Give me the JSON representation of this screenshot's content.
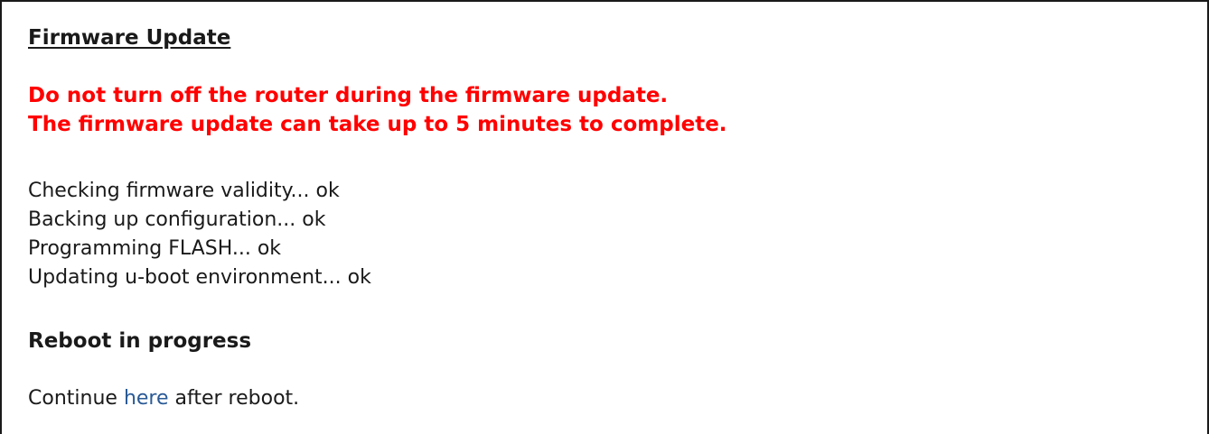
{
  "page": {
    "title": "Firmware Update",
    "warnings": [
      "Do not turn off the router during the firmware update.",
      "The firmware update can take up to 5 minutes to complete."
    ],
    "log": [
      "Checking firmware validity... ok",
      "Backing up configuration... ok",
      "Programming FLASH... ok",
      "Updating u-boot environment... ok"
    ],
    "reboot_heading": "Reboot in progress",
    "continue": {
      "prefix": "Continue",
      "link_text": "here",
      "suffix": "after reboot."
    }
  },
  "colors": {
    "warning": "#ff0000",
    "link": "#2a5a96",
    "text": "#1a1a1a",
    "border": "#1a1a1a"
  }
}
